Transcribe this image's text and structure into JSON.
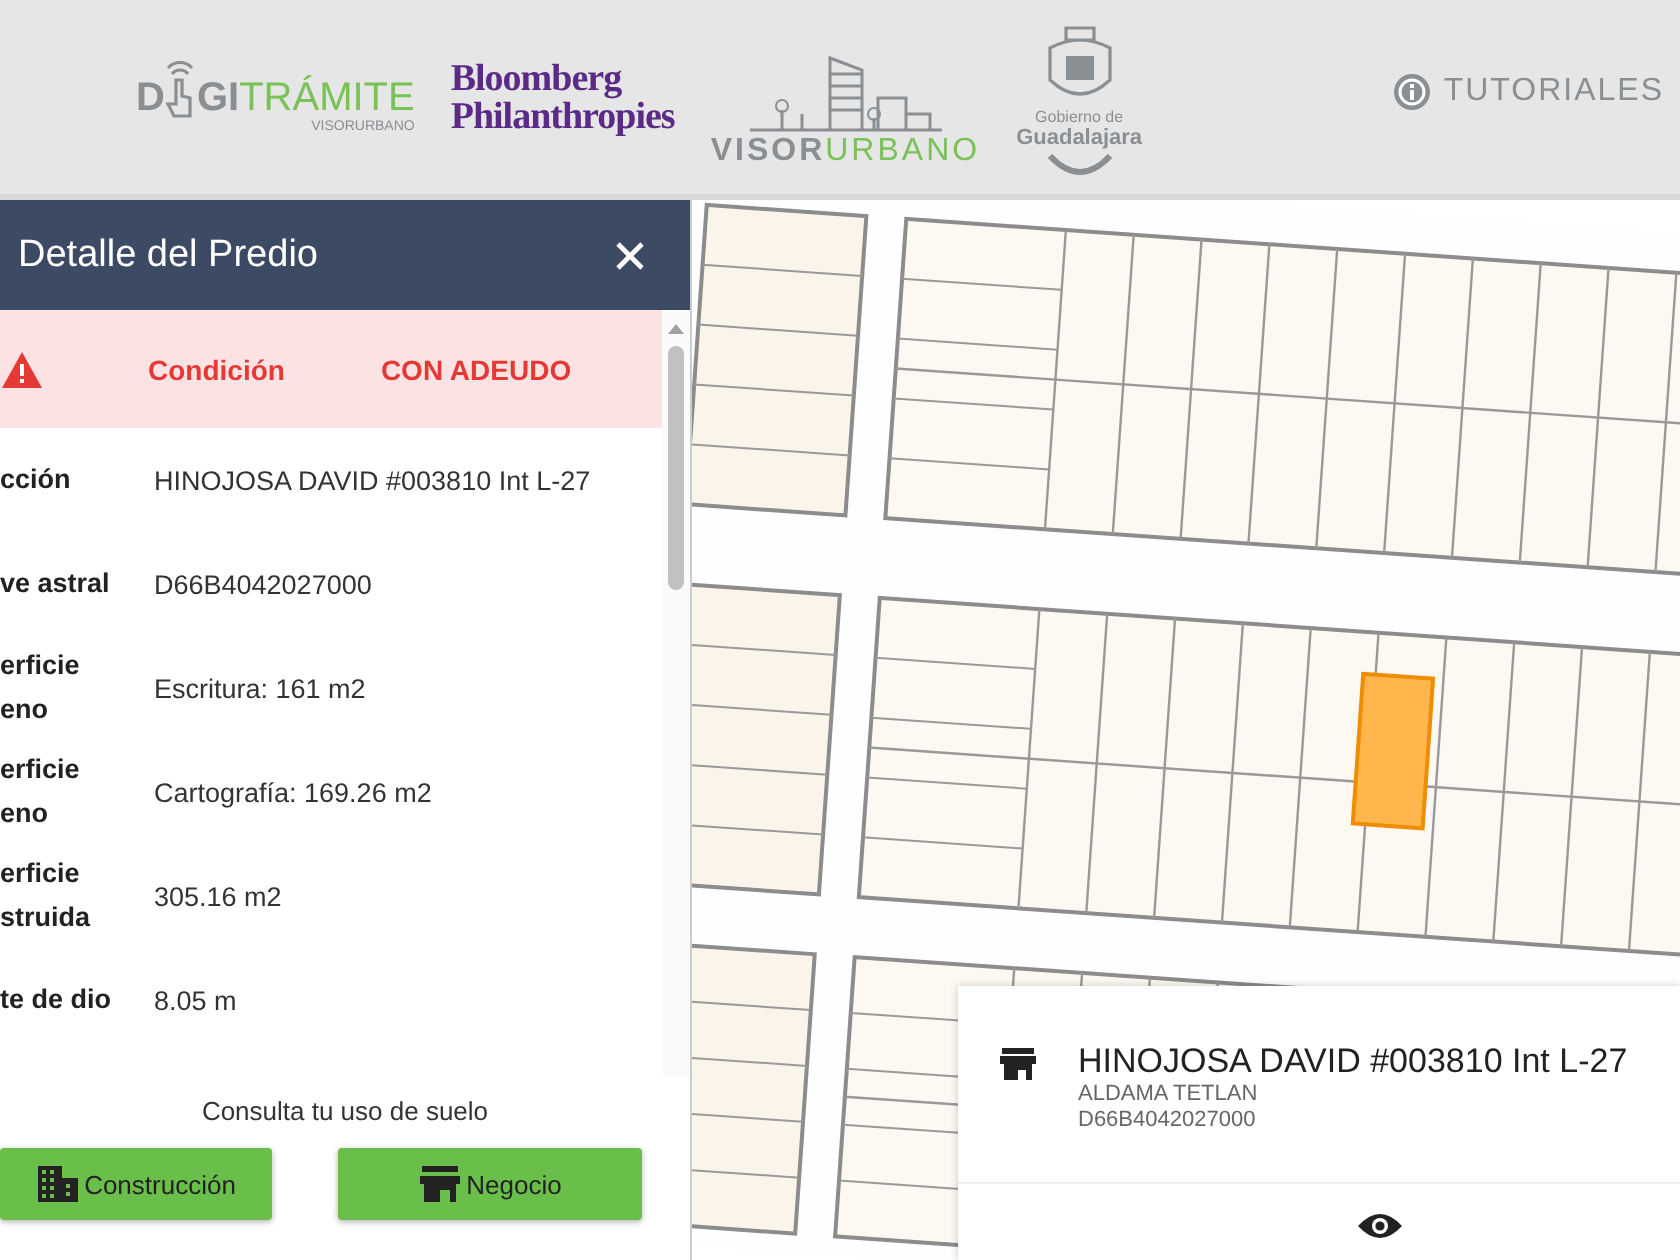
{
  "header": {
    "logos": [
      {
        "kind": "digitramite",
        "parts": [
          "D",
          "GI",
          "TRÁMITE"
        ],
        "subtitle": "VISORURBANO"
      },
      {
        "kind": "bloomberg",
        "lines": [
          "Bloomberg",
          "Philanthropies"
        ]
      },
      {
        "kind": "visorurbano",
        "parts": [
          "VISOR",
          "URBANO"
        ]
      },
      {
        "kind": "guadalajara",
        "lines": [
          "Gobierno de",
          "Guadalajara"
        ]
      }
    ],
    "tutorials": "TUTORIALES"
  },
  "panel": {
    "title": "Detalle del Predio",
    "alert": {
      "label": "Condición",
      "value": "CON ADEUDO"
    },
    "rows": [
      {
        "label": "cción",
        "value": "HINOJOSA DAVID #003810 Int L-27"
      },
      {
        "label": "ve astral",
        "value": "D66B4042027000"
      },
      {
        "label": "erficie eno",
        "value": "Escritura: 161 m2"
      },
      {
        "label": "erficie eno",
        "value": "Cartografía: 169.26 m2"
      },
      {
        "label": "erficie struida",
        "value": "305.16 m2"
      },
      {
        "label": "te de dio",
        "value": "8.05 m"
      }
    ],
    "prompt": "Consulta tu uso de suelo",
    "buttons": [
      {
        "kind": "construction",
        "label": "Construcción"
      },
      {
        "kind": "business",
        "label": "Negocio"
      }
    ]
  },
  "popup": {
    "title": "HINOJOSA DAVID #003810 Int L-27",
    "lines": [
      "ALDAMA TETLAN",
      "D66B4042027000"
    ]
  }
}
